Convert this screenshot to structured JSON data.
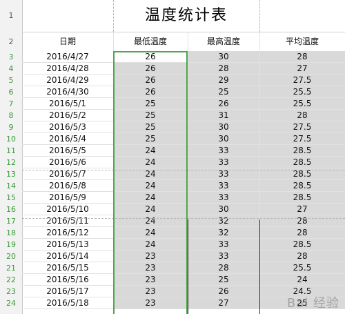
{
  "sheet": {
    "title": "温度统计表",
    "title_row_number": "1",
    "header_row_number": "2",
    "headers": {
      "date": "日期",
      "min": "最低温度",
      "max": "最高温度",
      "avg": "平均温度"
    },
    "rows": [
      {
        "n": "3",
        "date": "2016/4/27",
        "min": "26",
        "max": "30",
        "avg": "28"
      },
      {
        "n": "4",
        "date": "2016/4/28",
        "min": "26",
        "max": "28",
        "avg": "27"
      },
      {
        "n": "5",
        "date": "2016/4/29",
        "min": "26",
        "max": "29",
        "avg": "27.5"
      },
      {
        "n": "6",
        "date": "2016/4/30",
        "min": "26",
        "max": "25",
        "avg": "25.5"
      },
      {
        "n": "7",
        "date": "2016/5/1",
        "min": "25",
        "max": "26",
        "avg": "25.5"
      },
      {
        "n": "8",
        "date": "2016/5/2",
        "min": "25",
        "max": "31",
        "avg": "28"
      },
      {
        "n": "9",
        "date": "2016/5/3",
        "min": "25",
        "max": "30",
        "avg": "27.5"
      },
      {
        "n": "10",
        "date": "2016/5/4",
        "min": "25",
        "max": "30",
        "avg": "27.5"
      },
      {
        "n": "11",
        "date": "2016/5/5",
        "min": "24",
        "max": "33",
        "avg": "28.5"
      },
      {
        "n": "12",
        "date": "2016/5/6",
        "min": "24",
        "max": "33",
        "avg": "28.5"
      },
      {
        "n": "13",
        "date": "2016/5/7",
        "min": "24",
        "max": "33",
        "avg": "28.5"
      },
      {
        "n": "14",
        "date": "2016/5/8",
        "min": "24",
        "max": "33",
        "avg": "28.5"
      },
      {
        "n": "15",
        "date": "2016/5/9",
        "min": "24",
        "max": "33",
        "avg": "28.5"
      },
      {
        "n": "16",
        "date": "2016/5/10",
        "min": "24",
        "max": "30",
        "avg": "27"
      },
      {
        "n": "17",
        "date": "2016/5/11",
        "min": "24",
        "max": "32",
        "avg": "28"
      },
      {
        "n": "18",
        "date": "2016/5/12",
        "min": "24",
        "max": "32",
        "avg": "28"
      },
      {
        "n": "19",
        "date": "2016/5/13",
        "min": "24",
        "max": "33",
        "avg": "28.5"
      },
      {
        "n": "20",
        "date": "2016/5/14",
        "min": "23",
        "max": "33",
        "avg": "28"
      },
      {
        "n": "21",
        "date": "2016/5/15",
        "min": "23",
        "max": "28",
        "avg": "25.5"
      },
      {
        "n": "22",
        "date": "2016/5/16",
        "min": "23",
        "max": "25",
        "avg": "24"
      },
      {
        "n": "23",
        "date": "2016/5/17",
        "min": "23",
        "max": "26",
        "avg": "24.5"
      },
      {
        "n": "24",
        "date": "2016/5/18",
        "min": "23",
        "max": "27",
        "avg": "25"
      }
    ]
  },
  "watermark": {
    "text": "Bai 经验"
  },
  "colors": {
    "selection": "#4aa84a",
    "selected_fill": "#d9d9d9",
    "row_number": "#3a9a3a"
  }
}
